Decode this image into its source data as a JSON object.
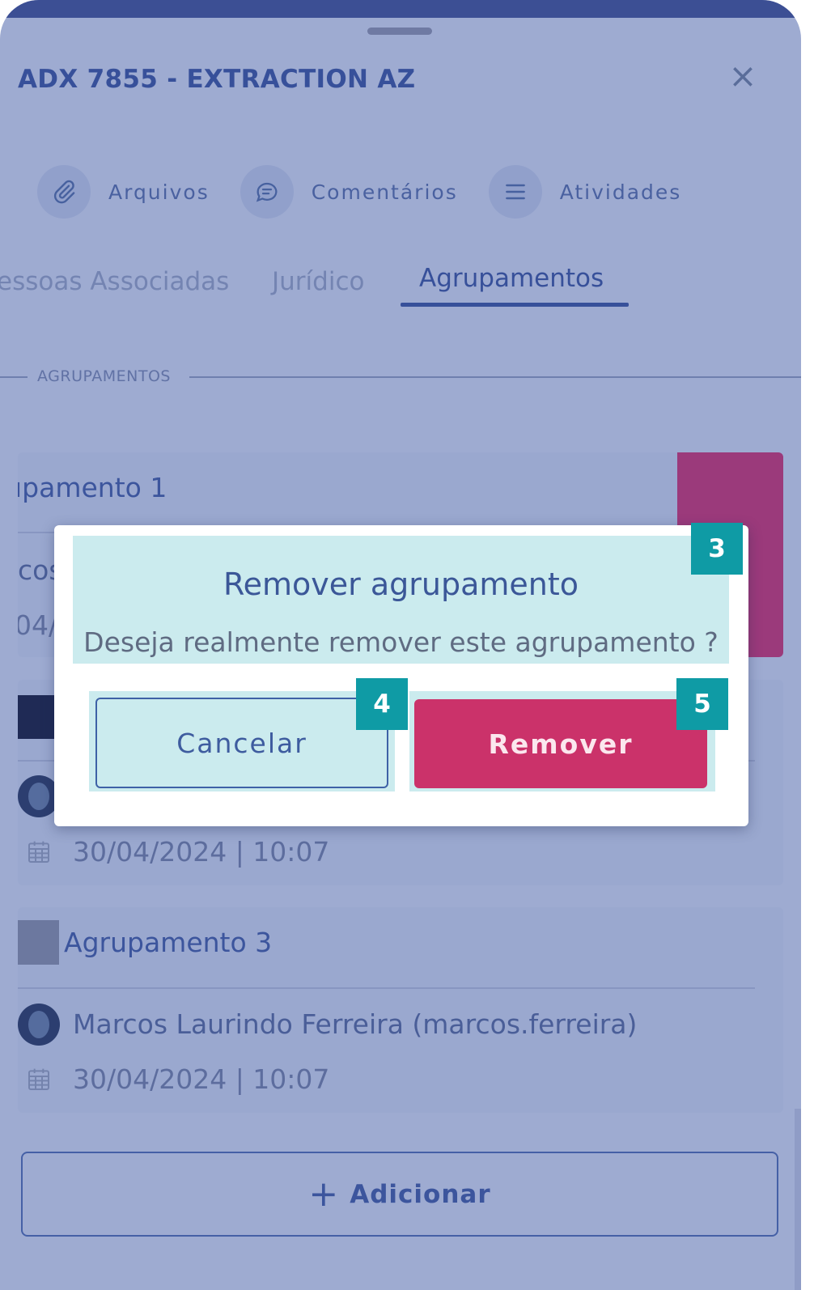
{
  "header": {
    "title": "ADX 7855 - EXTRACTION AZ",
    "close_label": "×"
  },
  "actions": [
    {
      "label": "Arquivos",
      "icon": "paperclip-icon"
    },
    {
      "label": "Comentários",
      "icon": "comment-icon"
    },
    {
      "label": "Atividades",
      "icon": "list-icon"
    }
  ],
  "tabs": [
    {
      "label": "essoas Associadas",
      "active": false
    },
    {
      "label": "Jurídico",
      "active": false
    },
    {
      "label": "Agrupamentos",
      "active": true
    }
  ],
  "section_title": "AGRUPAMENTOS",
  "groups": [
    {
      "name": "ıpamento 1",
      "user": "cos",
      "date": "04/",
      "color": "#9b3a7b"
    },
    {
      "name": "",
      "user": "",
      "date": "30/04/2024 | 10:07",
      "color": "#1f2a55"
    },
    {
      "name": "Agrupamento 3",
      "user": "Marcos Laurindo Ferreira (marcos.ferreira)",
      "date": "30/04/2024 | 10:07",
      "color": "#6c789f"
    }
  ],
  "add_button": {
    "plus": "+",
    "label": "Adicionar"
  },
  "dialog": {
    "title": "Remover agrupamento",
    "message": "Deseja realmente remover este agrupamento ?",
    "cancel_label": "Cancelar",
    "remove_label": "Remover",
    "badges": [
      "3",
      "4",
      "5"
    ]
  },
  "colors": {
    "overlay_bg": "#9eabd1",
    "primary": "#37509a",
    "danger": "#cb326a",
    "badge": "#0f9ba5",
    "highlight": "#cbebee"
  }
}
